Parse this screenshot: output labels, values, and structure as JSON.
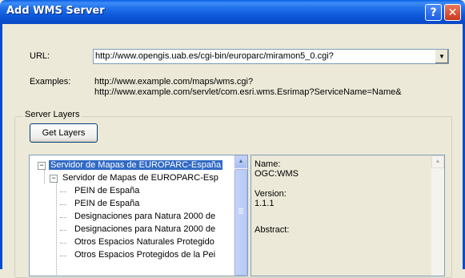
{
  "window": {
    "title": "Add WMS Server",
    "help_label": "?",
    "close_label": "✕"
  },
  "url": {
    "label": "URL:",
    "value": "http://www.opengis.uab.es/cgi-bin/europarc/miramon5_0.cgi?"
  },
  "examples": {
    "label": "Examples:",
    "line1": "http://www.example.com/maps/wms.cgi?",
    "line2": "http://www.example.com/servlet/com.esri.wms.Esrimap?ServiceName=Name&"
  },
  "server_layers": {
    "group_label": "Server Layers",
    "get_layers_label": "Get Layers",
    "tree": [
      {
        "label": "Servidor de Mapas de EUROPARC-España",
        "level": 0,
        "selected": true
      },
      {
        "label": "Servidor de Mapas de EUROPARC-Esp",
        "level": 1
      },
      {
        "label": "PEIN de España",
        "level": 2
      },
      {
        "label": "PEIN de España",
        "level": 2
      },
      {
        "label": "Designaciones para Natura 2000 de",
        "level": 2
      },
      {
        "label": "Designaciones para Natura 2000 de",
        "level": 2
      },
      {
        "label": "Otros Espacios Naturales Protegido",
        "level": 2
      },
      {
        "label": "Otros Espacios Protegidos de la Pei",
        "level": 2
      }
    ],
    "info": {
      "name_label": "Name:",
      "name_value": "OGC:WMS",
      "version_label": "Version:",
      "version_value": "1.1.1",
      "abstract_label": "Abstract:"
    }
  }
}
